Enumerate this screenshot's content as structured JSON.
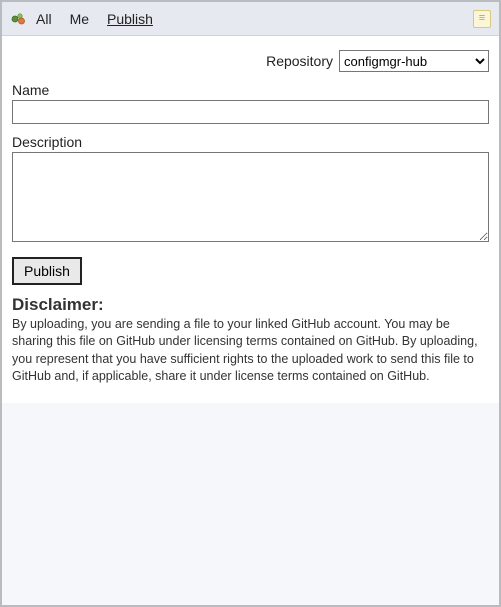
{
  "toolbar": {
    "tabs": {
      "all": "All",
      "me": "Me",
      "publish": "Publish"
    }
  },
  "form": {
    "repository_label": "Repository",
    "repository_selected": "configmgr-hub",
    "name_label": "Name",
    "name_value": "",
    "description_label": "Description",
    "description_value": "",
    "publish_button": "Publish"
  },
  "disclaimer": {
    "heading": "Disclaimer:",
    "body": "By uploading, you are sending a file to your linked GitHub account. You may be sharing this file on GitHub under licensing terms contained on GitHub. By uploading, you represent that you have sufficient rights to the uploaded work to send this file to GitHub and, if applicable, share it under license terms contained on GitHub."
  }
}
